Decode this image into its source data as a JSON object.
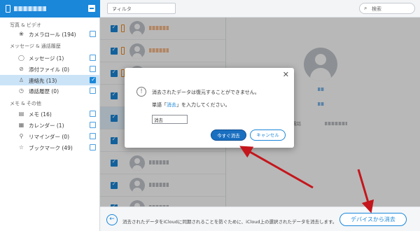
{
  "sidebar": {
    "sections": [
      "写真 & ビデオ",
      "メッセージ & 通話履歴",
      "メモ & その他"
    ],
    "items": [
      {
        "label": "カメラロール (194)",
        "icon": "photo-icon",
        "checked": false
      },
      {
        "label": "メッセージ (1)",
        "icon": "message-icon",
        "checked": false
      },
      {
        "label": "添付ファイル (0)",
        "icon": "paperclip-icon",
        "checked": false
      },
      {
        "label": "連絡先 (13)",
        "icon": "contact-icon",
        "checked": true,
        "active": true
      },
      {
        "label": "通話履歴 (0)",
        "icon": "clock-icon",
        "checked": false
      },
      {
        "label": "メモ (16)",
        "icon": "note-icon",
        "checked": false
      },
      {
        "label": "カレンダー (1)",
        "icon": "calendar-icon",
        "checked": false
      },
      {
        "label": "リマインダー (0)",
        "icon": "reminder-icon",
        "checked": false
      },
      {
        "label": "ブックマーク (49)",
        "icon": "bookmark-icon",
        "checked": false
      }
    ]
  },
  "topbar": {
    "filter_label": "フィルタ",
    "search_placeholder": "検索"
  },
  "detail": {
    "phone_label": "電話"
  },
  "dialog": {
    "message1": "消去されたデータは復元することができません。",
    "message2_prefix": "単語「",
    "message2_keyword": "消去",
    "message2_suffix": "」を入力してください。",
    "input_value": "消去",
    "delete_button": "今すぐ消去",
    "cancel_button": "キャンセル"
  },
  "bottombar": {
    "text": "消去されたデータをiCloudに同期されることを防ぐために、iCloud上の選択されたデータを消去します。",
    "erase_button": "デバイスから消去"
  },
  "colors": {
    "accent": "#1a87d9",
    "annotation_arrow": "#c4161c"
  }
}
